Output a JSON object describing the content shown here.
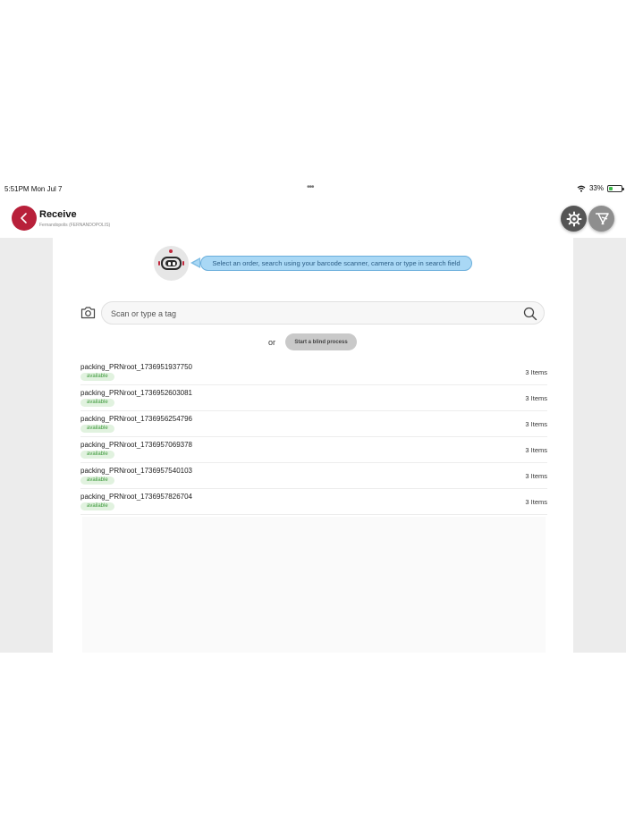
{
  "status_bar": {
    "time": "5:51PM  Mon Jul 7",
    "dots": "•••",
    "battery": "33%",
    "battery_level": 0.33
  },
  "header": {
    "title": "Receive",
    "subtitle": "Fernandopolis (FERNANDOPOLIS)"
  },
  "assistant": {
    "hint": "Select an order, search using your barcode scanner, camera or type in search field"
  },
  "search": {
    "placeholder": "Scan or type a tag",
    "value": ""
  },
  "blind": {
    "or_label": "or",
    "button_label": "Start a blind process"
  },
  "orders": [
    {
      "name": "packing_PRNroot_1736951937750",
      "status": "available",
      "count": "3 Items"
    },
    {
      "name": "packing_PRNroot_1736952603081",
      "status": "available",
      "count": "3 Items"
    },
    {
      "name": "packing_PRNroot_1736956254796",
      "status": "available",
      "count": "3 Items"
    },
    {
      "name": "packing_PRNroot_1736957069378",
      "status": "available",
      "count": "3 Items"
    },
    {
      "name": "packing_PRNroot_1736957540103",
      "status": "available",
      "count": "3 Items"
    },
    {
      "name": "packing_PRNroot_1736957826704",
      "status": "available",
      "count": "3 Items"
    }
  ],
  "colors": {
    "brand": "#b8203a",
    "hint_bg": "#a9d8f5",
    "status_available_bg": "#e1f2df",
    "status_available_text": "#3e9a3c"
  },
  "icons": {
    "back": "chevron-left-icon",
    "settings": "gear-icon",
    "logo": "brand-logo-icon",
    "camera": "camera-icon",
    "search": "search-icon",
    "assistant": "robot-icon"
  }
}
